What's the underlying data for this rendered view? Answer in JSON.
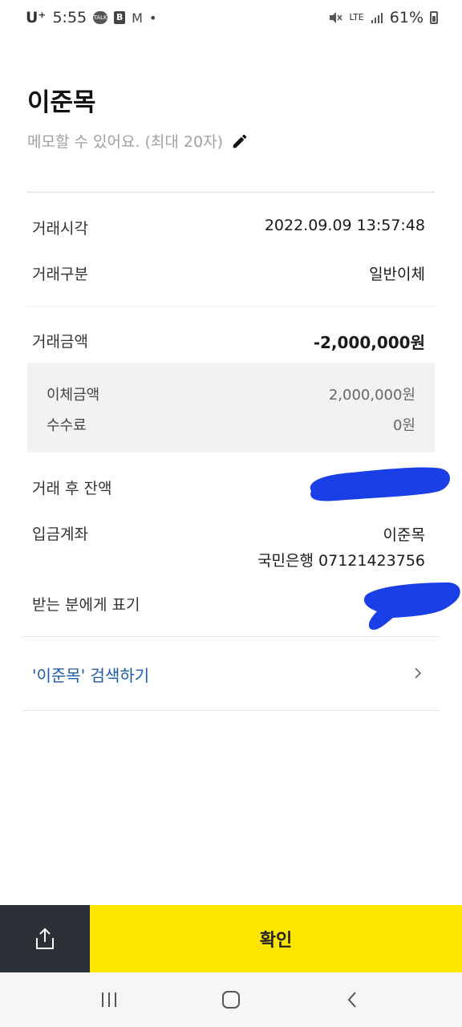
{
  "status_bar": {
    "carrier": "U⁺",
    "time": "5:55",
    "talk_badge": "TALK",
    "b_badge": "B",
    "mail_glyph": "M",
    "dot": "•",
    "network": "LTE",
    "battery": "61%"
  },
  "header": {
    "title": "이준목",
    "memo_placeholder": "메모할 수 있어요. (최대 20자)"
  },
  "transaction": {
    "time_label": "거래시각",
    "time_value": "2022.09.09 13:57:48",
    "type_label": "거래구분",
    "type_value": "일반이체",
    "amount_label": "거래금액",
    "amount_value": "-2,000,000원",
    "transfer_label": "이체금액",
    "transfer_value": "2,000,000원",
    "fee_label": "수수료",
    "fee_value": "0원",
    "balance_label": "거래 후 잔액",
    "account_label": "입금계좌",
    "account_name": "이준목",
    "account_number": "국민은행 07121423756",
    "display_label": "받는 분에게 표기"
  },
  "search": {
    "label": "'이준목' 검색하기"
  },
  "bottom": {
    "confirm_label": "확인"
  },
  "icons": {
    "share": "share-icon",
    "pencil": "pencil-icon",
    "chevron": "chevron-right-icon"
  },
  "colors": {
    "confirm_bg": "#fee500",
    "share_bg": "#2c3138",
    "link": "#1c5aa8",
    "redaction": "#1a3fe6"
  }
}
